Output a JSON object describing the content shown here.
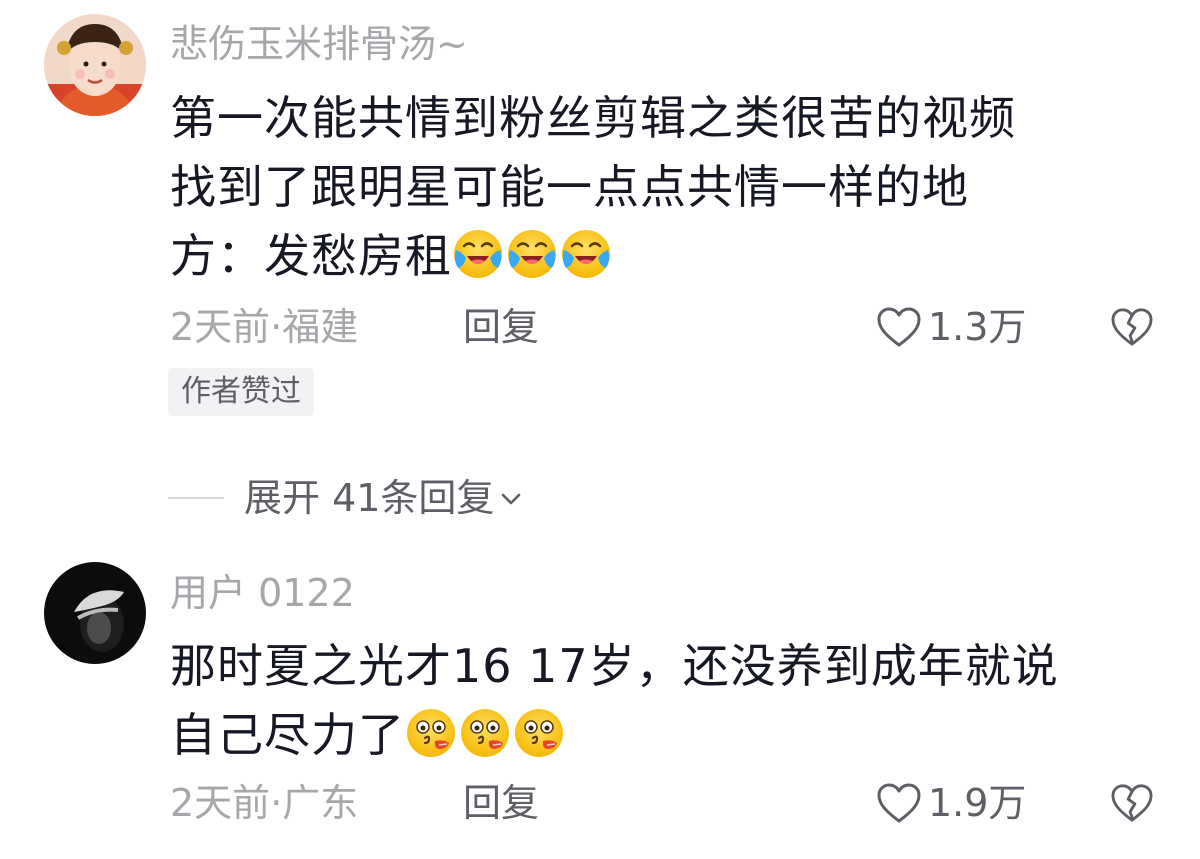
{
  "comments": [
    {
      "username": "悲伤玉米排骨汤~",
      "lines": [
        "第一次能共情到粉丝剪辑之类很苦的视频",
        "找到了跟明星可能一点点共情一样的地",
        "方：发愁房租"
      ],
      "emoji_name": "loudly-crying-face",
      "emoji_count": 3,
      "time": "2天前",
      "location": "福建",
      "meta_separator": "·",
      "reply_label": "回复",
      "like_count": "1.3万",
      "author_liked": "作者赞过"
    },
    {
      "username": "用户 0122",
      "lines": [
        "那时夏之光才16 17岁，还没养到成年就说",
        "自己尽力了"
      ],
      "emoji_name": "kiss-face",
      "emoji_count": 3,
      "time": "2天前",
      "location": "广东",
      "meta_separator": "·",
      "reply_label": "回复",
      "like_count": "1.9万"
    }
  ],
  "expand": {
    "label": "展开 41条回复"
  },
  "colors": {
    "text_primary": "#161823",
    "text_secondary": "#a6a7ab",
    "text_action": "#5e5f66",
    "tag_background": "#f2f2f4"
  },
  "icons": {
    "like": "heart-outline-icon",
    "dislike": "broken-heart-icon",
    "expand": "chevron-down-icon"
  }
}
